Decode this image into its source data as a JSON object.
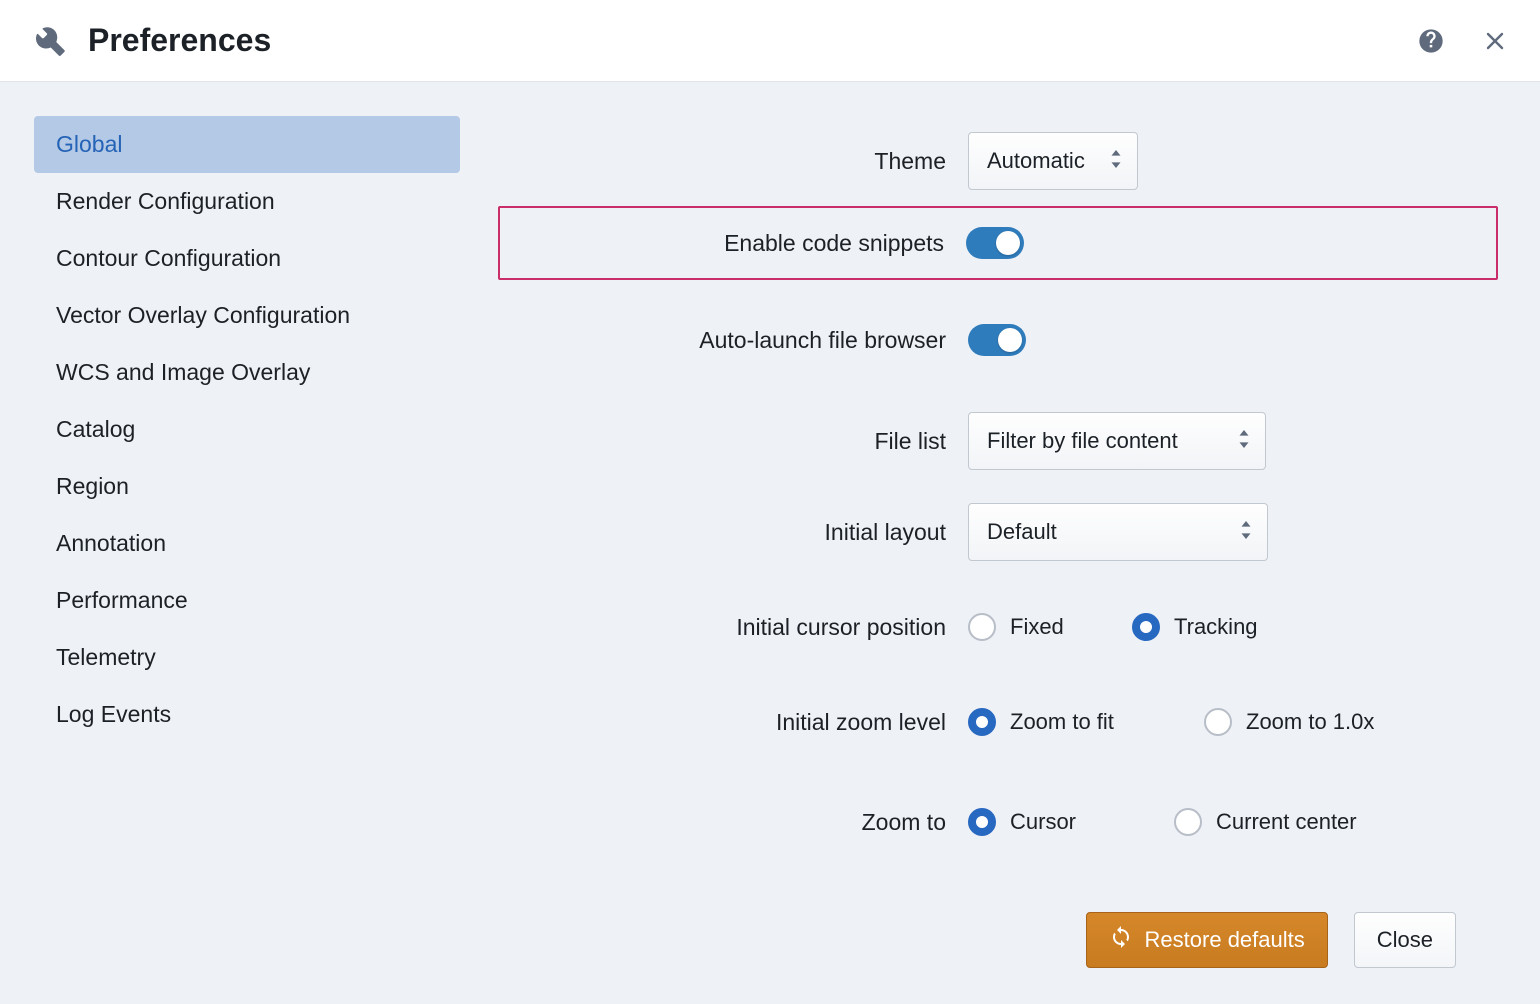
{
  "header": {
    "title": "Preferences"
  },
  "sidebar": {
    "items": [
      {
        "label": "Global",
        "active": true
      },
      {
        "label": "Render Configuration",
        "active": false
      },
      {
        "label": "Contour Configuration",
        "active": false
      },
      {
        "label": "Vector Overlay Configuration",
        "active": false
      },
      {
        "label": "WCS and Image Overlay",
        "active": false
      },
      {
        "label": "Catalog",
        "active": false
      },
      {
        "label": "Region",
        "active": false
      },
      {
        "label": "Annotation",
        "active": false
      },
      {
        "label": "Performance",
        "active": false
      },
      {
        "label": "Telemetry",
        "active": false
      },
      {
        "label": "Log Events",
        "active": false
      }
    ]
  },
  "form": {
    "theme": {
      "label": "Theme",
      "value": "Automatic"
    },
    "snippets": {
      "label": "Enable code snippets",
      "on": true
    },
    "autolaunch": {
      "label": "Auto-launch file browser",
      "on": true
    },
    "filelist": {
      "label": "File list",
      "value": "Filter by file content"
    },
    "layout": {
      "label": "Initial layout",
      "value": "Default"
    },
    "cursor": {
      "label": "Initial cursor position",
      "options": [
        {
          "label": "Fixed",
          "checked": false
        },
        {
          "label": "Tracking",
          "checked": true
        }
      ]
    },
    "zoom_level": {
      "label": "Initial zoom level",
      "options": [
        {
          "label": "Zoom to fit",
          "checked": true
        },
        {
          "label": "Zoom to 1.0x",
          "checked": false
        }
      ]
    },
    "zoom_to": {
      "label": "Zoom to",
      "options": [
        {
          "label": "Cursor",
          "checked": true
        },
        {
          "label": "Current center",
          "checked": false
        }
      ]
    }
  },
  "footer": {
    "restore": "Restore defaults",
    "close": "Close"
  }
}
